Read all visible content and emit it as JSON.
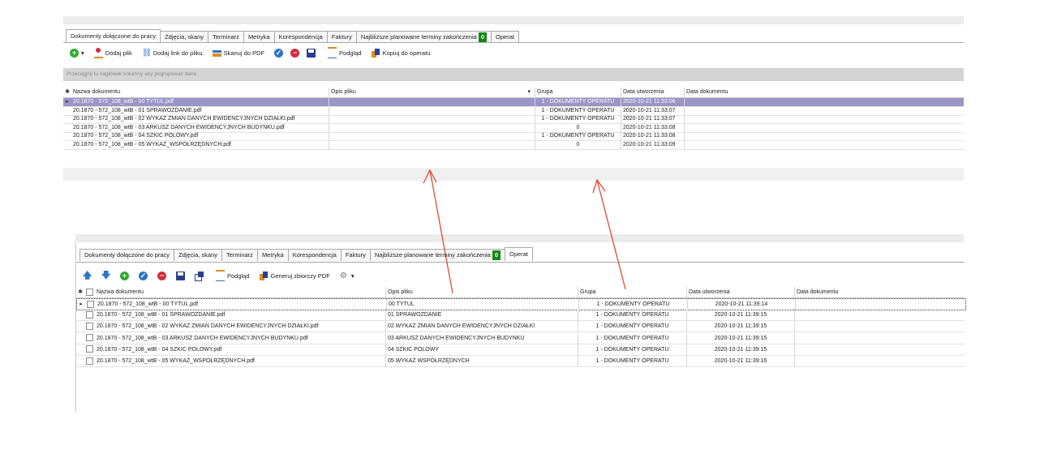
{
  "top": {
    "tabs": [
      {
        "label": "Dokumenty dołączone do pracy",
        "active": true
      },
      {
        "label": "Zdjęcia, skany"
      },
      {
        "label": "Terminarz"
      },
      {
        "label": "Metryka"
      },
      {
        "label": "Korespondencja"
      },
      {
        "label": "Faktury"
      },
      {
        "label": "Najbliższe planowane terminy zakończenia"
      },
      {
        "label": "Operat"
      }
    ],
    "badge": "0",
    "toolbar": {
      "add_file": "Dodaj plik",
      "add_link": "Dodaj link do pliku",
      "scan": "Skanuj do PDF",
      "preview": "Podgląd",
      "copy": "Kopiuj do operatu"
    },
    "group_hint": "Przeciągnij tu nagłówek kolumny aby pogrupować dane",
    "columns": [
      "Nazwa dokumentu",
      "Opis pliku",
      "Grupa",
      "Data utworzenia",
      "Data dokumentu"
    ],
    "rows": [
      {
        "name": "20.1870 - 572_108_wtB - 00 TYTUL.pdf",
        "desc": "",
        "group": "1 - DOKUMENTY OPERATU",
        "created": "2020-10-21 11:33:06",
        "docdate": ""
      },
      {
        "name": "20.1870 - 572_108_wtB - 01 SPRAWOZDANIE.pdf",
        "desc": "",
        "group": "1 - DOKUMENTY OPERATU",
        "created": "2020-10-21 11:33:07",
        "docdate": ""
      },
      {
        "name": "20.1870 - 572_108_wtB - 02 WYKAZ ZMIAN DANYCH EWIDENCYJNYCH DZIAŁKI.pdf",
        "desc": "",
        "group": "1 - DOKUMENTY OPERATU",
        "created": "2020-10-21 11:33:07",
        "docdate": ""
      },
      {
        "name": "20.1870 - 572_108_wtB - 03 ARKUSZ DANYCH EWIDENCYJNYCH BUDYNKU.pdf",
        "desc": "",
        "group": "0",
        "created": "2020-10-21 11:33:08",
        "docdate": ""
      },
      {
        "name": "20.1870 - 572_108_wtB - 04 SZKIC POLOWY.pdf",
        "desc": "",
        "group": "1 - DOKUMENTY OPERATU",
        "created": "2020-10-21 11:33:08",
        "docdate": ""
      },
      {
        "name": "20.1870 - 572_108_wtB - 05 WYKAZ_WSPÓŁRZĘDNYCH.pdf",
        "desc": "",
        "group": "0",
        "created": "2020-10-21 11:33:09",
        "docdate": ""
      }
    ]
  },
  "bottom": {
    "tabs": [
      {
        "label": "Dokumenty dołączone do pracy"
      },
      {
        "label": "Zdjęcia, skany"
      },
      {
        "label": "Terminarz"
      },
      {
        "label": "Metryka"
      },
      {
        "label": "Korespondencja"
      },
      {
        "label": "Faktury"
      },
      {
        "label": "Najbliższe planowane terminy zakończenia"
      },
      {
        "label": "Operat",
        "active": true
      }
    ],
    "badge": "0",
    "toolbar": {
      "preview": "Podgląd",
      "generate": "Generuj zbiorczy PDF"
    },
    "columns": [
      "Nazwa dokumentu",
      "Opis pliku",
      "Grupa",
      "Data utworzenia",
      "Data dokumentu"
    ],
    "rows": [
      {
        "name": "20.1870 - 572_108_wtB - 00 TYTUL.pdf",
        "desc": "00 TYTUL",
        "group": "1 - DOKUMENTY OPERATU",
        "created": "2020-10-21 11:39:14",
        "docdate": ""
      },
      {
        "name": "20.1870 - 572_108_wtB - 01 SPRAWOZDANIE.pdf",
        "desc": "01 SPRAWOZDANIE",
        "group": "1 - DOKUMENTY OPERATU",
        "created": "2020-10-21 11:39:15",
        "docdate": ""
      },
      {
        "name": "20.1870 - 572_108_wtB - 02 WYKAZ ZMIAN DANYCH EWIDENCYJNYCH DZIAŁKI.pdf",
        "desc": "02 WYKAZ ZMIAN DANYCH EWIDENCYJNYCH DZIAŁKI",
        "group": "1 - DOKUMENTY OPERATU",
        "created": "2020-10-21 11:39:15",
        "docdate": ""
      },
      {
        "name": "20.1870 - 572_108_wtB - 03 ARKUSZ DANYCH EWIDENCYJNYCH BUDYNKU.pdf",
        "desc": "03 ARKUSZ DANYCH EWIDENCYJNYCH BUDYNKU",
        "group": "1 - DOKUMENTY OPERATU",
        "created": "2020-10-21 11:39:15",
        "docdate": ""
      },
      {
        "name": "20.1870 - 572_108_wtB - 04 SZKIC POLOWY.pdf",
        "desc": "04 SZKIC POLOWY",
        "group": "1 - DOKUMENTY OPERATU",
        "created": "2020-10-21 11:39:15",
        "docdate": ""
      },
      {
        "name": "20.1870 - 572_108_wtB - 05 WYKAZ_WSPÓŁRZĘDNYCH.pdf",
        "desc": "05 WYKAZ WSPÓŁRZĘDNYCH",
        "group": "1 - DOKUMENTY OPERATU",
        "created": "2020-10-21 11:39:16",
        "docdate": ""
      }
    ]
  },
  "colors": {
    "selected_row": "#9a95c9",
    "badge": "#128a12",
    "arrow": "#e04a3c"
  }
}
